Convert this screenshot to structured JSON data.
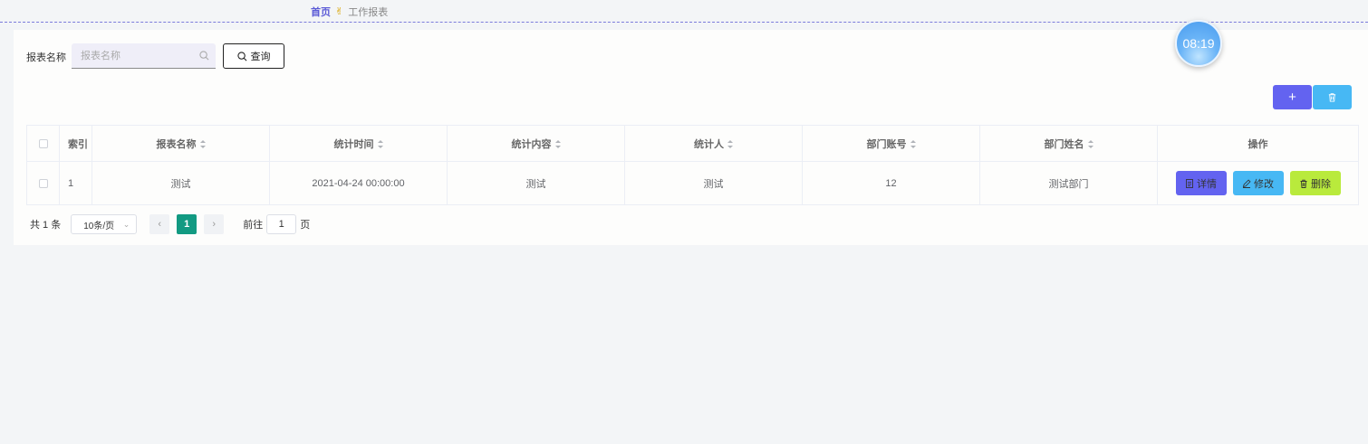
{
  "breadcrumb": {
    "home": "首页",
    "separator": "✌",
    "current": "工作报表"
  },
  "search": {
    "label": "报表名称",
    "placeholder": "报表名称",
    "value": "",
    "button_label": "查询"
  },
  "clock": {
    "time": "08:19"
  },
  "toolbar": {
    "add_icon": "plus-icon",
    "add_label": "+",
    "delete_icon": "trash-icon"
  },
  "table": {
    "columns": [
      "索引",
      "报表名称",
      "统计时间",
      "统计内容",
      "统计人",
      "部门账号",
      "部门姓名",
      "操作"
    ],
    "rows": [
      {
        "index": "1",
        "name": "测试",
        "time": "2021-04-24 00:00:00",
        "content": "测试",
        "person": "测试",
        "dept_account": "12",
        "dept_name": "测试部门",
        "actions": {
          "detail": "详情",
          "edit": "修改",
          "delete": "删除"
        }
      }
    ]
  },
  "pagination": {
    "total": "共 1 条",
    "page_size": "10条/页",
    "current_page": "1",
    "jump_label": "前往",
    "jump_value": "1",
    "jump_suffix": "页"
  },
  "colors": {
    "primary": "#6363f0",
    "info": "#47b8f4",
    "lime": "#b9ea3c",
    "page_active": "#129a82"
  }
}
